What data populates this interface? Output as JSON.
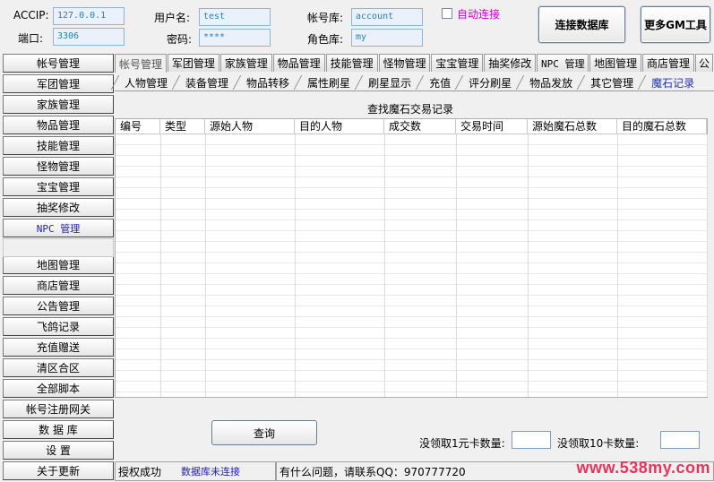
{
  "connection": {
    "accip_label": "ACCIP:",
    "accip_value": "127.0.0.1",
    "port_label": "端口:",
    "port_value": "3306",
    "username_label": "用户名:",
    "username_value": "test",
    "password_label": "密码:",
    "password_value": "****",
    "account_db_label": "帐号库:",
    "account_db_value": "account",
    "role_db_label": "角色库:",
    "role_db_value": "my",
    "auto_connect_label": "自动连接",
    "auto_connect_checked": false,
    "connect_button": "连接数据库",
    "more_gm_button": "更多GM工具"
  },
  "sidebar": {
    "items": [
      "帐号管理",
      "军团管理",
      "家族管理",
      "物品管理",
      "技能管理",
      "怪物管理",
      "宝宝管理",
      "抽奖修改",
      "NPC 管理",
      "地图管理",
      "商店管理",
      "公告管理",
      "飞鸽记录",
      "充值赠送",
      "清区合区",
      "全部脚本",
      "帐号注册网关",
      "数 据 库",
      "设    置",
      "关于更新"
    ]
  },
  "top_tabs": [
    "帐号管理",
    "军团管理",
    "家族管理",
    "物品管理",
    "技能管理",
    "怪物管理",
    "宝宝管理",
    "抽奖修改",
    "NPC 管理",
    "地图管理",
    "商店管理",
    "公"
  ],
  "sub_tabs": [
    "人物管理",
    "装备管理",
    "物品转移",
    "属性刷星",
    "刷星显示",
    "充值",
    "评分刷星",
    "物品发放",
    "其它管理",
    "魔石记录"
  ],
  "grid": {
    "title": "查找魔石交易记录",
    "columns": [
      "编号",
      "类型",
      "源始人物",
      "目的人物",
      "成交数",
      "交易时间",
      "源始魔石总数",
      "目的魔石总数"
    ]
  },
  "query_button": "查询",
  "unclaimed_1yuan_label": "没领取1元卡数量:",
  "unclaimed_1yuan_value": "",
  "unclaimed_10_label": "没领取10卡数量:",
  "unclaimed_10_value": "",
  "status": {
    "auth": "授权成功",
    "db": "数据库未连接",
    "contact": "有什么问题，请联系QQ：970777720",
    "watermark": "www.538my.com"
  },
  "colors": {
    "field_text": "#2a7fb0",
    "auto_connect": "#cc00cc",
    "db_status": "#2222aa",
    "watermark": "#e8345a"
  }
}
